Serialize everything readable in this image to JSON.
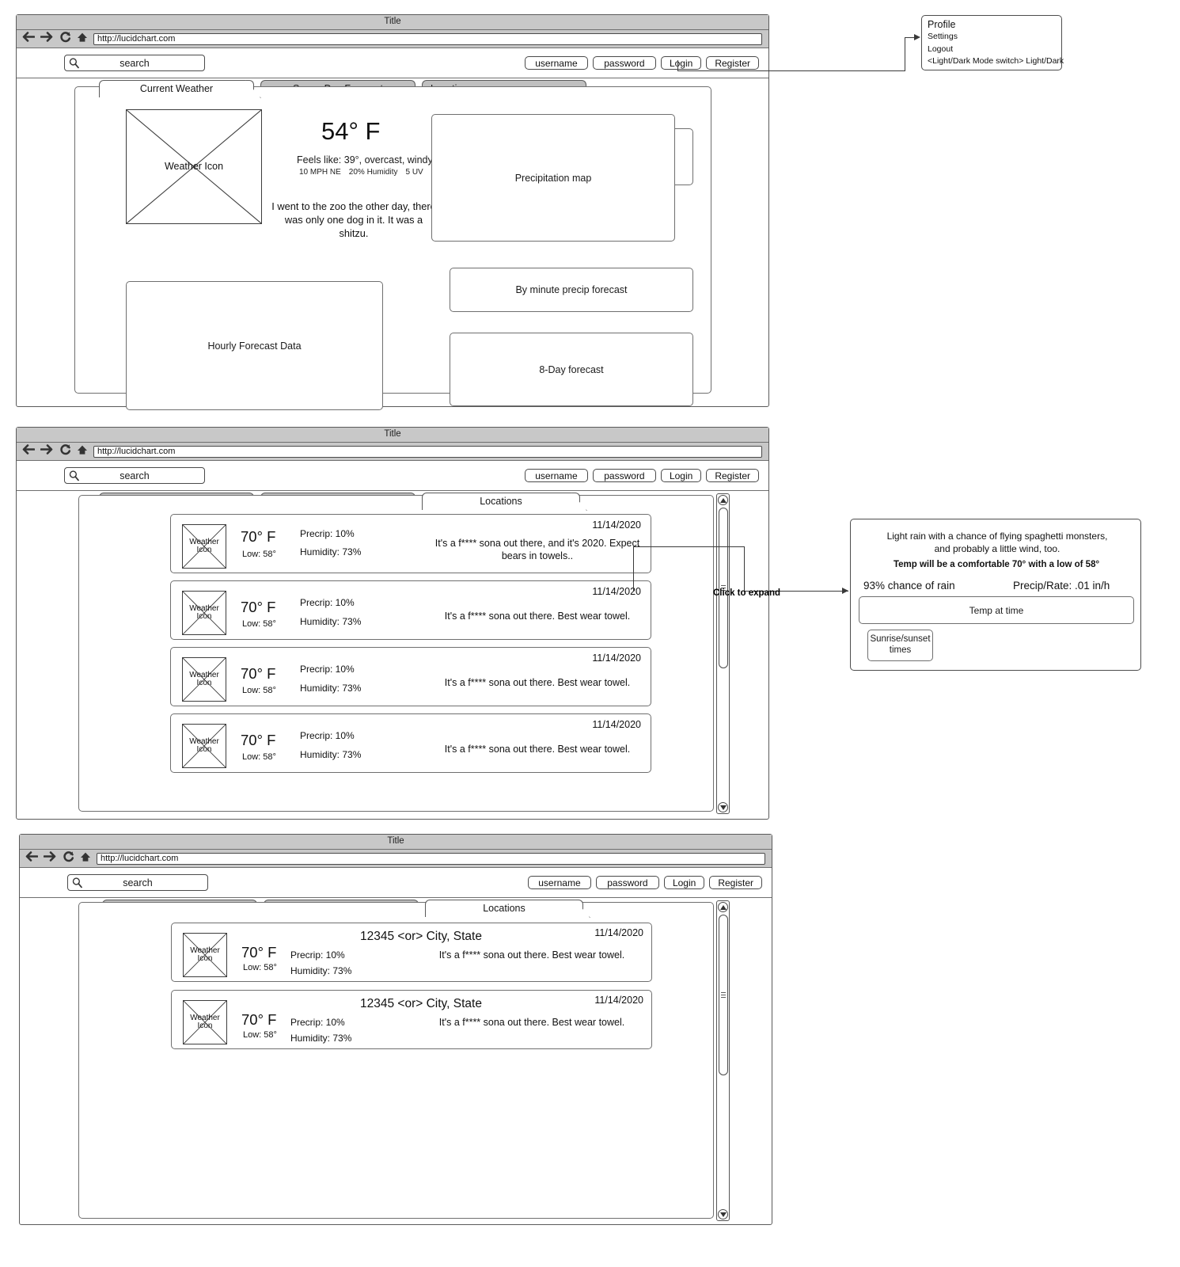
{
  "browser": {
    "title": "Title",
    "url": "http://lucidchart.com",
    "nav_icons": [
      "back-arrow-icon",
      "forward-arrow-icon",
      "reload-icon",
      "home-icon"
    ]
  },
  "toolbar": {
    "search_text": "search",
    "search_icon": "magnifier-icon",
    "username_label": "username",
    "password_label": "password",
    "login_label": "Login",
    "register_label": "Register"
  },
  "tabs": {
    "current_weather": "Current Weather",
    "seven_day": "Seven-Day Forecast",
    "locations": "Locations"
  },
  "profile_menu": {
    "items": [
      "Profile",
      "Settings",
      "Logout",
      "<Light/Dark Mode switch> Light/Dark"
    ]
  },
  "current_weather": {
    "weather_icon_label": "Weather Icon",
    "temperature": "54° F",
    "feels_like": "Feels like: 39°, overcast, windy",
    "metrics": [
      "10 MPH NE",
      "20% Humidity",
      "5 UV"
    ],
    "blurb": "I went to the zoo the other day, there was only one dog in it. It was a shitzu.",
    "precipitation_map": "Precipitation map",
    "by_minute": "By minute precip forecast",
    "eight_day": "8-Day forecast",
    "hourly": "Hourly Forecast Data"
  },
  "locations_window": {
    "click_to_expand": "Click to expand",
    "cards": [
      {
        "icon_label": "Weather Icon",
        "temp": "70°  F",
        "low": "Low: 58°",
        "precip": "Precrip: 10%",
        "humidity": "Humidity: 73%",
        "date": "11/14/2020",
        "desc": "It's a f**** sona out there, and it's 2020. Expect bears in towels.."
      },
      {
        "icon_label": "Weather Icon",
        "temp": "70°  F",
        "low": "Low: 58°",
        "precip": "Precrip: 10%",
        "humidity": "Humidity: 73%",
        "date": "11/14/2020",
        "desc": "It's a f**** sona out there. Best wear towel."
      },
      {
        "icon_label": "Weather Icon",
        "temp": "70°  F",
        "low": "Low: 58°",
        "precip": "Precrip: 10%",
        "humidity": "Humidity: 73%",
        "date": "11/14/2020",
        "desc": "It's a f**** sona out there. Best wear towel."
      },
      {
        "icon_label": "Weather Icon",
        "temp": "70°  F",
        "low": "Low: 58°",
        "precip": "Precrip: 10%",
        "humidity": "Humidity: 73%",
        "date": "11/14/2020",
        "desc": "It's a f**** sona out there. Best wear towel."
      }
    ]
  },
  "expanded_detail": {
    "summary": "Light rain with a chance of flying spaghetti monsters, and probably a little wind, too.",
    "temp_line": "Temp will be a comfortable 70°  with a low  of 58°",
    "chance_of_rain": "93% chance of rain",
    "precip_rate": "Precip/Rate: .01 in/h",
    "temp_at_time": "Temp  at time",
    "sunrise_sunset": "Sunrise/sunset times"
  },
  "search_window": {
    "cards": [
      {
        "icon_label": "Weather Icon",
        "place": "12345 <or> City, State",
        "temp": "70°  F",
        "low": "Low: 58°",
        "precip": "Precrip: 10%",
        "humidity": "Humidity: 73%",
        "date": "11/14/2020",
        "desc": "It's a f**** sona out there. Best wear towel."
      },
      {
        "icon_label": "Weather Icon",
        "place": "12345 <or> City, State",
        "temp": "70°  F",
        "low": "Low: 58°",
        "precip": "Precrip: 10%",
        "humidity": "Humidity: 73%",
        "date": "11/14/2020",
        "desc": "It's a f**** sona out there. Best wear towel."
      }
    ]
  },
  "colors": {
    "chrome_gray": "#c8c8c8",
    "tab_inactive": "#bfbfbf",
    "border": "#6f6f6f"
  }
}
